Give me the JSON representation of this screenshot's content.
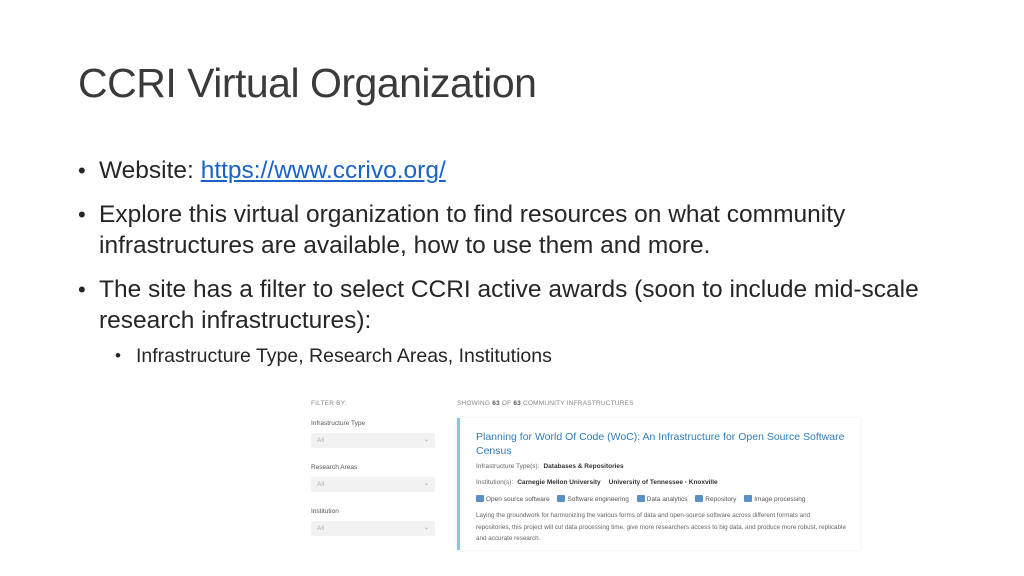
{
  "slide": {
    "title": "CCRI Virtual Organization",
    "bullet1_prefix": "Website: ",
    "bullet1_link": "https://www.ccrivo.org/",
    "bullet2": "Explore this virtual organization to find resources on what community infrastructures are available, how to use them and more.",
    "bullet3": "The site has a filter to select CCRI active awards (soon to include mid-scale research infrastructures):",
    "subbullet": "Infrastructure Type, Research Areas, Institutions"
  },
  "screenshot": {
    "filter_by": "FILTER BY:",
    "filters": [
      {
        "label": "Infrastructure Type",
        "value": "All"
      },
      {
        "label": "Research Areas",
        "value": "All"
      },
      {
        "label": "Institution",
        "value": "All"
      }
    ],
    "showing_prefix": "SHOWING",
    "showing_count": "63",
    "showing_of": "OF",
    "showing_total": "63",
    "showing_suffix": "COMMUNITY INFRASTRUCTURES",
    "card": {
      "title": "Planning for World Of Code (WoC): An Infrastructure for Open Source Software Census",
      "type_label": "Infrastructure Type(s):",
      "type_value": "Databases & Repositories",
      "inst_label": "Institution(s):",
      "inst_1": "Carnegie Mellon University",
      "inst_2": "University of Tennessee - Knoxville",
      "tags": [
        "Open source software",
        "Software engineering",
        "Data analytics",
        "Repository",
        "Image processing"
      ],
      "description": "Laying the groundwork for harmonizing the various forms of data and open-source software across different formats and repositories, this project will cut data processing time, give more researchers access to big data, and produce more robust, replicable and accurate research."
    }
  },
  "colors": {
    "link": "#1a63c6",
    "card_title": "#2f7bb8",
    "card_border": "#8cc6d6"
  }
}
